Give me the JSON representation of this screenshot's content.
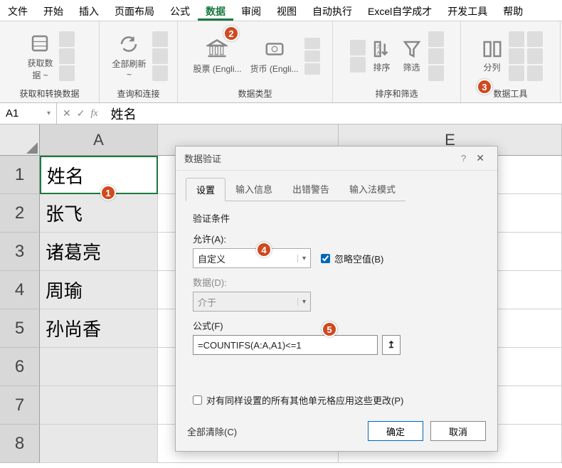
{
  "ribbon": {
    "tabs": [
      "文件",
      "开始",
      "插入",
      "页面布局",
      "公式",
      "数据",
      "审阅",
      "视图",
      "自动执行",
      "Excel自学成才",
      "开发工具",
      "帮助"
    ],
    "active": 5,
    "groups": {
      "g1": {
        "btn1": "获取数\n据 ~",
        "label": "获取和转换数据"
      },
      "g2": {
        "btn1": "全部刷新\n~",
        "label": "查询和连接"
      },
      "g3": {
        "btn1": "股票 (Engli...",
        "btn2": "货币 (Engli...",
        "label": "数据类型"
      },
      "g4": {
        "btn1": "排序",
        "btn2": "筛选",
        "label": "排序和筛选"
      },
      "g5": {
        "btn1": "分列",
        "label": "数据工具"
      }
    }
  },
  "formula_bar": {
    "name_box": "A1",
    "value": "姓名"
  },
  "sheet": {
    "col_letters": [
      "A",
      "E"
    ],
    "rows": [
      "1",
      "2",
      "3",
      "4",
      "5",
      "6",
      "7",
      "8"
    ],
    "colA": {
      "r1": "姓名",
      "r2": "张飞",
      "r3": "诸葛亮",
      "r4": "周瑜",
      "r5": "孙尚香"
    }
  },
  "dialog": {
    "title": "数据验证",
    "tabs": [
      "设置",
      "输入信息",
      "出错警告",
      "输入法模式"
    ],
    "active_tab": 0,
    "section": "验证条件",
    "allow_label": "允许(A):",
    "allow_value": "自定义",
    "ignore_blank": "忽略空值(B)",
    "data_label": "数据(D):",
    "data_value": "介于",
    "formula_label": "公式(F)",
    "formula_value": "=COUNTIFS(A:A,A1)<=1",
    "apply_all": "对有同样设置的所有其他单元格应用这些更改(P)",
    "clear": "全部清除(C)",
    "ok": "确定",
    "cancel": "取消"
  },
  "badges": {
    "b1": "1",
    "b2": "2",
    "b3": "3",
    "b4": "4",
    "b5": "5"
  }
}
